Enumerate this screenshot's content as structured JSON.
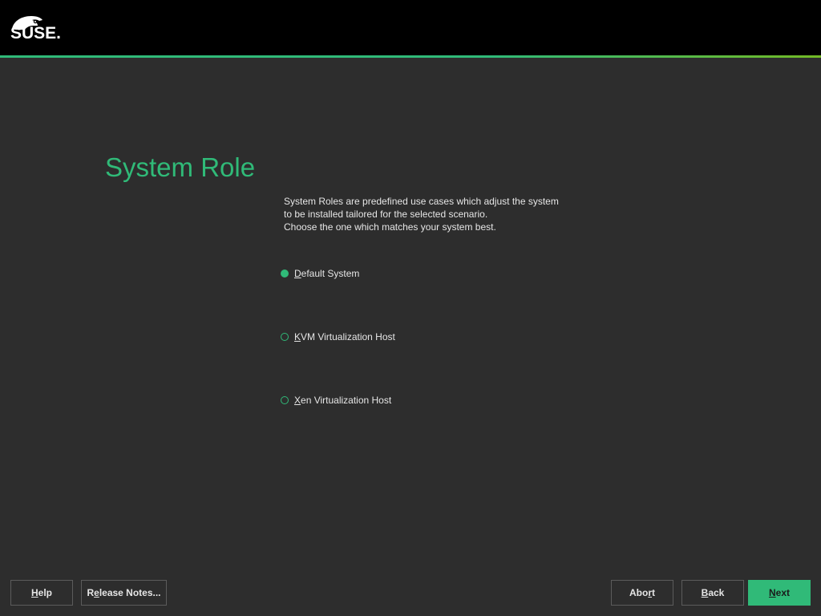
{
  "header": {
    "logo_text": "SUSE."
  },
  "colors": {
    "accent": "#30ba78",
    "background": "#2d2d2d",
    "header": "#000000"
  },
  "page": {
    "title": "System Role",
    "description_lines": [
      "System Roles are predefined use cases which adjust the system",
      "to be installed tailored for the selected scenario.",
      "Choose the one which matches your system best."
    ]
  },
  "roles": [
    {
      "mnemonic": "D",
      "rest": "efault System",
      "checked": true
    },
    {
      "mnemonic": "K",
      "rest": "VM Virtualization Host",
      "checked": false
    },
    {
      "mnemonic": "X",
      "rest": "en Virtualization Host",
      "checked": false
    }
  ],
  "buttons": {
    "help": {
      "pre": "",
      "mnemonic": "H",
      "post": "elp"
    },
    "release_notes": {
      "pre": "R",
      "mnemonic": "e",
      "post": "lease Notes..."
    },
    "abort": {
      "pre": "Abo",
      "mnemonic": "r",
      "post": "t"
    },
    "back": {
      "pre": "",
      "mnemonic": "B",
      "post": "ack"
    },
    "next": {
      "pre": "",
      "mnemonic": "N",
      "post": "ext"
    }
  }
}
